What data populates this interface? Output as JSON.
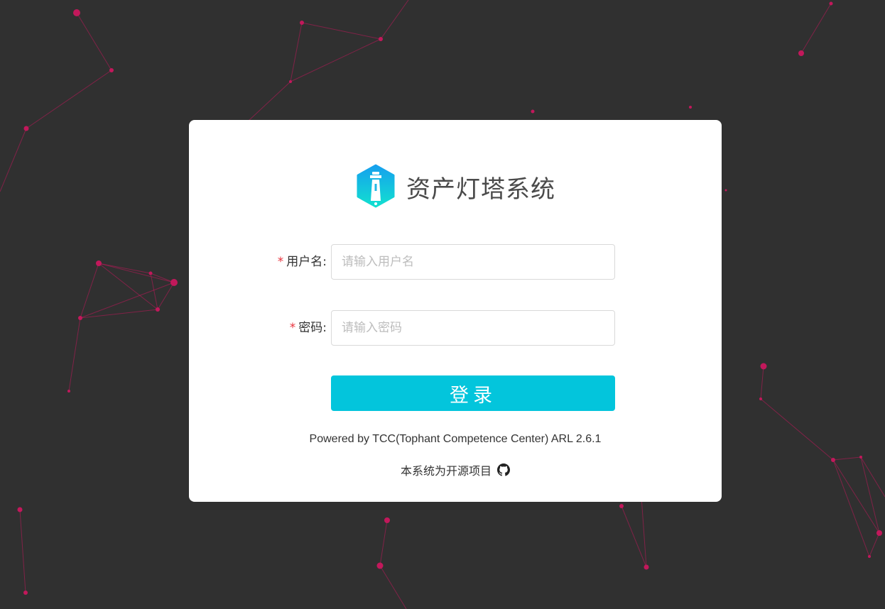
{
  "app": {
    "title": "资产灯塔系统",
    "logo_icon": "lighthouse-icon"
  },
  "form": {
    "username": {
      "required_mark": "*",
      "label": "用户名:",
      "placeholder": "请输入用户名",
      "value": ""
    },
    "password": {
      "required_mark": "*",
      "label": "密码:",
      "placeholder": "请输入密码",
      "value": ""
    },
    "login_label": "登录"
  },
  "footer": {
    "powered_by": "Powered by TCC(Tophant Competence Center) ARL 2.6.1",
    "open_source_text": "本系统为开源项目",
    "open_source_icon": "github-icon"
  },
  "colors": {
    "background": "#303030",
    "network": "#c2185b",
    "accent": "#03c5dc",
    "required": "#e8323c"
  }
}
